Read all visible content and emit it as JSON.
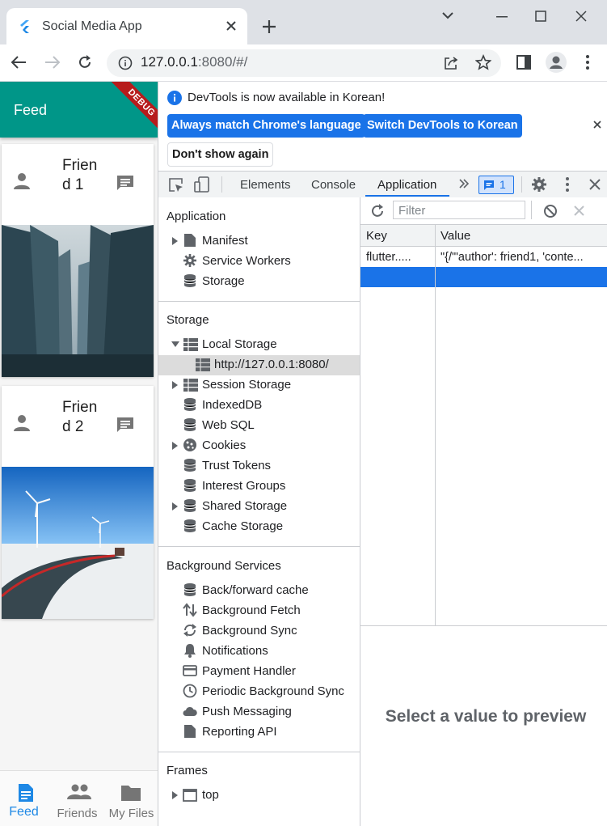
{
  "browser": {
    "tab_title": "Social Media App",
    "url_host": "127.0.0.1",
    "url_rest": ":8080/#/"
  },
  "app": {
    "appbar_title": "Feed",
    "debug_banner": "DEBUG",
    "posts": [
      {
        "name": "Friend 1"
      },
      {
        "name": "Friend 2"
      }
    ],
    "bottom_nav": [
      {
        "label": "Feed",
        "icon": "article-icon",
        "active": true
      },
      {
        "label": "Friends",
        "icon": "people-icon",
        "active": false
      },
      {
        "label": "My Files",
        "icon": "folder-icon",
        "active": false
      }
    ]
  },
  "devtools": {
    "infobar": {
      "message": "DevTools is now available in Korean!",
      "match_language": "Always match Chrome's language",
      "switch_korean": "Switch DevTools to Korean",
      "dont_show": "Don't show again"
    },
    "tabs": {
      "elements": "Elements",
      "console": "Console",
      "application": "Application",
      "issues_count": "1"
    },
    "sidebar": {
      "application_title": "Application",
      "application_items": [
        "Manifest",
        "Service Workers",
        "Storage"
      ],
      "storage_title": "Storage",
      "local_storage": "Local Storage",
      "local_storage_origin": "http://127.0.0.1:8080/",
      "storage_items": [
        "Session Storage",
        "IndexedDB",
        "Web SQL",
        "Cookies",
        "Trust Tokens",
        "Interest Groups",
        "Shared Storage",
        "Cache Storage"
      ],
      "background_title": "Background Services",
      "background_items": [
        "Back/forward cache",
        "Background Fetch",
        "Background Sync",
        "Notifications",
        "Payment Handler",
        "Periodic Background Sync",
        "Push Messaging",
        "Reporting API"
      ],
      "frames_title": "Frames",
      "frames_top": "top"
    },
    "storage_table": {
      "filter_placeholder": "Filter",
      "col_key": "Key",
      "col_value": "Value",
      "rows": [
        {
          "key": "flutter.....",
          "value": "\"{/\"'author': friend1, 'conte..."
        }
      ],
      "preview_text": "Select a value to preview"
    }
  },
  "colors": {
    "appbar": "#009688",
    "accent": "#1a73e8",
    "debug": "#b71c1c"
  }
}
